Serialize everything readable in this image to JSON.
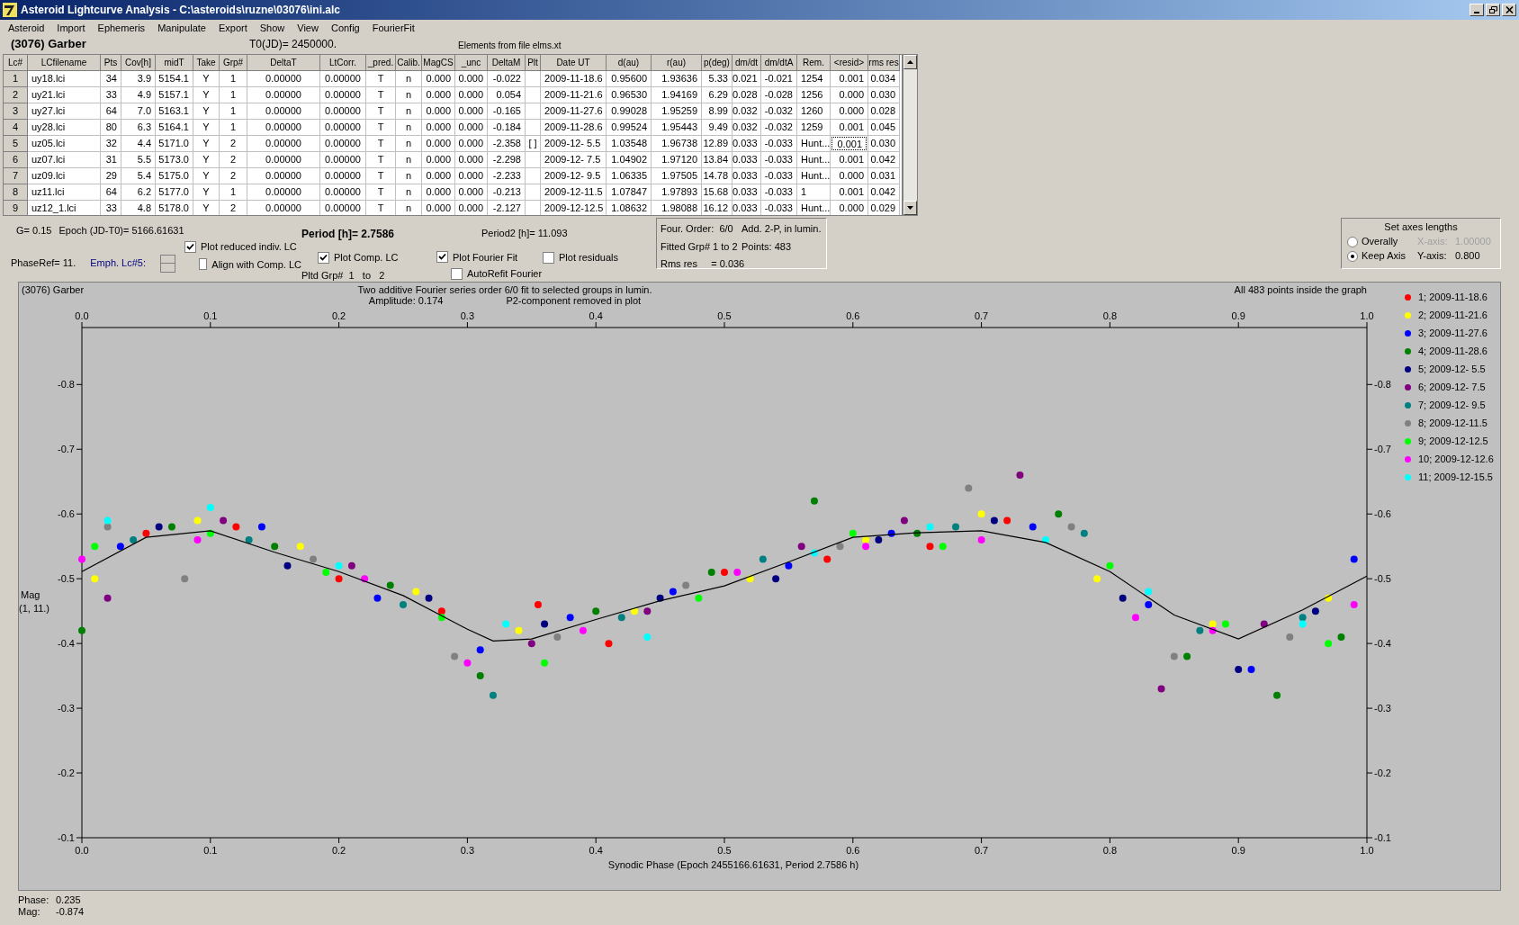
{
  "window": {
    "title": "Asteroid Lightcurve Analysis - C:\\asteroids\\ruzne\\03076\\ini.alc"
  },
  "menu": [
    "Asteroid",
    "Import",
    "Ephemeris",
    "Manipulate",
    "Export",
    "Show",
    "View",
    "Config",
    "FourierFit"
  ],
  "header": {
    "asteroid": "(3076) Garber",
    "t0": "T0(JD)= 2450000.",
    "elements": "Elements from file elms.xt"
  },
  "table": {
    "columns": [
      "Lc#",
      "LCfilename",
      "Pts",
      "Cov[h]",
      "midT",
      "Take",
      "Grp#",
      "DeltaT",
      "LtCorr.",
      "_pred.",
      "Calib.",
      "MagCS",
      "_unc",
      "DeltaM",
      "Plt",
      "Date UT",
      "d(au)",
      "r(au)",
      "p(deg)",
      "dm/dt",
      "dm/dtA",
      "Rem.",
      "<resid>",
      "rms res"
    ],
    "rows": [
      {
        "cells": [
          "1",
          "uy18.lci",
          "34",
          "3.9",
          "5154.1",
          "Y",
          "1",
          "0.00000",
          "0.00000",
          "T",
          "n",
          "0.000",
          "0.000",
          "-0.022",
          null,
          "2009-11-18.6",
          "0.95600",
          "1.93636",
          "5.33",
          "0.021",
          "-0.021",
          "1254",
          "0.001",
          "0.034"
        ],
        "resid_focused": false
      },
      {
        "cells": [
          "2",
          "uy21.lci",
          "33",
          "4.9",
          "5157.1",
          "Y",
          "1",
          "0.00000",
          "0.00000",
          "T",
          "n",
          "0.000",
          "0.000",
          "0.054",
          null,
          "2009-11-21.6",
          "0.96530",
          "1.94169",
          "6.29",
          "0.028",
          "-0.028",
          "1256",
          "0.000",
          "0.030"
        ],
        "resid_focused": false
      },
      {
        "cells": [
          "3",
          "uy27.lci",
          "64",
          "7.0",
          "5163.1",
          "Y",
          "1",
          "0.00000",
          "0.00000",
          "T",
          "n",
          "0.000",
          "0.000",
          "-0.165",
          null,
          "2009-11-27.6",
          "0.99028",
          "1.95259",
          "8.99",
          "0.032",
          "-0.032",
          "1260",
          "0.000",
          "0.028"
        ],
        "resid_focused": false
      },
      {
        "cells": [
          "4",
          "uy28.lci",
          "80",
          "6.3",
          "5164.1",
          "Y",
          "1",
          "0.00000",
          "0.00000",
          "T",
          "n",
          "0.000",
          "0.000",
          "-0.184",
          null,
          "2009-11-28.6",
          "0.99524",
          "1.95443",
          "9.49",
          "0.032",
          "-0.032",
          "1259",
          "0.001",
          "0.045"
        ],
        "resid_focused": false
      },
      {
        "cells": [
          "5",
          "uz05.lci",
          "32",
          "4.4",
          "5171.0",
          "Y",
          "2",
          "0.00000",
          "0.00000",
          "T",
          "n",
          "0.000",
          "0.000",
          "-2.358",
          "[ ]",
          "2009-12- 5.5",
          "1.03548",
          "1.96738",
          "12.89",
          "0.033",
          "-0.033",
          "Hunt...",
          "0.001",
          "0.030"
        ],
        "resid_focused": true
      },
      {
        "cells": [
          "6",
          "uz07.lci",
          "31",
          "5.5",
          "5173.0",
          "Y",
          "2",
          "0.00000",
          "0.00000",
          "T",
          "n",
          "0.000",
          "0.000",
          "-2.298",
          null,
          "2009-12- 7.5",
          "1.04902",
          "1.97120",
          "13.84",
          "0.033",
          "-0.033",
          "Hunt...",
          "0.001",
          "0.042"
        ],
        "resid_focused": false
      },
      {
        "cells": [
          "7",
          "uz09.lci",
          "29",
          "5.4",
          "5175.0",
          "Y",
          "2",
          "0.00000",
          "0.00000",
          "T",
          "n",
          "0.000",
          "0.000",
          "-2.233",
          null,
          "2009-12- 9.5",
          "1.06335",
          "1.97505",
          "14.78",
          "0.033",
          "-0.033",
          "Hunt...",
          "0.000",
          "0.031"
        ],
        "resid_focused": false
      },
      {
        "cells": [
          "8",
          "uz11.lci",
          "64",
          "6.2",
          "5177.0",
          "Y",
          "1",
          "0.00000",
          "0.00000",
          "T",
          "n",
          "0.000",
          "0.000",
          "-0.213",
          null,
          "2009-12-11.5",
          "1.07847",
          "1.97893",
          "15.68",
          "0.033",
          "-0.033",
          "1",
          "0.001",
          "0.042"
        ],
        "resid_focused": false
      },
      {
        "cells": [
          "9",
          "uz12_1.lci",
          "33",
          "4.8",
          "5178.0",
          "Y",
          "2",
          "0.00000",
          "0.00000",
          "T",
          "n",
          "0.000",
          "0.000",
          "-2.127",
          null,
          "2009-12-12.5",
          "1.08632",
          "1.98088",
          "16.12",
          "0.033",
          "-0.033",
          "Hunt...",
          "0.000",
          "0.029"
        ],
        "resid_focused": false
      }
    ]
  },
  "params": {
    "g": "G= 0.15",
    "epoch": "Epoch (JD-T0)= 5166.61631",
    "period": "Period [h]= 2.7586",
    "period2": "Period2 [h]= 11.093",
    "phaseref": "PhaseRef= 11.",
    "emph": "Emph. Lc#5:",
    "pltd_grp": "Pltd Grp#  1   to   2"
  },
  "checkboxes": [
    {
      "label": "Plot reduced indiv. LC",
      "checked": true
    },
    {
      "label": "Align with Comp. LC",
      "checked": false
    },
    {
      "label": "Plot Comp. LC",
      "checked": true
    },
    {
      "label": "Plot Fourier Fit",
      "checked": true
    },
    {
      "label": "AutoRefit Fourier",
      "checked": false
    },
    {
      "label": "Plot residuals",
      "checked": false
    }
  ],
  "fit_info": [
    "Four. Order:  6/0",
    "Add. 2-P, in lumin.",
    "Fitted Grp# 1 to 2",
    "Points: 483",
    "Rms res     = 0.036"
  ],
  "axes_box": {
    "title": "Set axes lengths",
    "options": [
      {
        "label": "Overally",
        "selected": false
      },
      {
        "label": "Keep Axis",
        "selected": true
      }
    ],
    "axes": [
      {
        "label": "X-axis:",
        "value": "1.00000",
        "disabled": true
      },
      {
        "label": "Y-axis:",
        "value": "0.800",
        "disabled": false
      }
    ]
  },
  "plot": {
    "name": "(3076) Garber",
    "subtitle": "Two additive Fourier series order 6/0 fit to selected groups in lumin.",
    "amplitude": "Amplitude: 0.174",
    "note": "P2-component removed in plot",
    "points_note": "All 483 points inside the graph",
    "ylabel_unit": "(1, 11.)",
    "right_axis_labels": [
      "-0.8",
      "-0.7",
      "-0.6",
      "-0.5",
      "-0.4",
      "-0.3",
      "-0.2",
      "-0.1"
    ],
    "chart_data": {
      "type": "scatter",
      "xlabel": "Synodic Phase (Epoch 2455166.61631, Period 2.7586 h)",
      "ylabel": "Mag",
      "xlim": [
        0,
        1
      ],
      "ylim": [
        -0.1,
        -0.888
      ],
      "xticks": [
        {
          "value": 0,
          "label": "0.0"
        },
        {
          "value": 0.1,
          "label": "0.1"
        },
        {
          "value": 0.2,
          "label": "0.2"
        },
        {
          "value": 0.3,
          "label": "0.3"
        },
        {
          "value": 0.4,
          "label": "0.4"
        },
        {
          "value": 0.5,
          "label": "0.5"
        },
        {
          "value": 0.6,
          "label": "0.6"
        },
        {
          "value": 0.7,
          "label": "0.7"
        },
        {
          "value": 0.8,
          "label": "0.8"
        },
        {
          "value": 0.9,
          "label": "0.9"
        },
        {
          "value": 1,
          "label": "1.0"
        }
      ],
      "yticks": [
        -0.1,
        -0.2,
        -0.3,
        -0.4,
        -0.5,
        -0.6,
        -0.7,
        -0.8
      ],
      "series": [
        {
          "name": "1; 2009-11-18.6",
          "color": "#ff0000",
          "x": [
            0.05,
            0.12,
            0.2,
            0.28,
            0.355,
            0.41,
            0.5,
            0.58,
            0.66,
            0.72
          ],
          "values": [
            -0.57,
            -0.58,
            -0.5,
            -0.45,
            -0.46,
            -0.4,
            -0.51,
            -0.53,
            -0.55,
            -0.59
          ]
        },
        {
          "name": "2; 2009-11-21.6",
          "color": "#ffff00",
          "x": [
            0.01,
            0.09,
            0.17,
            0.26,
            0.34,
            0.43,
            0.52,
            0.61,
            0.7,
            0.79,
            0.88,
            0.97
          ],
          "values": [
            -0.5,
            -0.59,
            -0.55,
            -0.48,
            -0.42,
            -0.45,
            -0.5,
            -0.56,
            -0.6,
            -0.5,
            -0.43,
            -0.47
          ]
        },
        {
          "name": "3; 2009-11-27.6",
          "color": "#0000ff",
          "x": [
            0.03,
            0.14,
            0.23,
            0.31,
            0.38,
            0.46,
            0.55,
            0.63,
            0.74,
            0.83,
            0.91,
            0.99
          ],
          "values": [
            -0.55,
            -0.58,
            -0.47,
            -0.39,
            -0.44,
            -0.48,
            -0.52,
            -0.57,
            -0.58,
            -0.46,
            -0.36,
            -0.53
          ]
        },
        {
          "name": "4; 2009-11-28.6",
          "color": "#008000",
          "x": [
            0.0,
            0.07,
            0.15,
            0.24,
            0.31,
            0.4,
            0.49,
            0.57,
            0.65,
            0.76,
            0.86,
            0.93,
            0.98
          ],
          "values": [
            -0.42,
            -0.58,
            -0.55,
            -0.49,
            -0.35,
            -0.45,
            -0.51,
            -0.62,
            -0.57,
            -0.6,
            -0.38,
            -0.32,
            -0.41
          ]
        },
        {
          "name": "5; 2009-12- 5.5",
          "color": "#000080",
          "x": [
            0.06,
            0.16,
            0.27,
            0.36,
            0.45,
            0.54,
            0.62,
            0.71,
            0.81,
            0.9,
            0.96
          ],
          "values": [
            -0.58,
            -0.52,
            -0.47,
            -0.43,
            -0.47,
            -0.5,
            -0.56,
            -0.59,
            -0.47,
            -0.36,
            -0.45
          ]
        },
        {
          "name": "6; 2009-12- 7.5",
          "color": "#800080",
          "x": [
            0.02,
            0.11,
            0.21,
            0.35,
            0.44,
            0.56,
            0.64,
            0.73,
            0.84,
            0.92
          ],
          "values": [
            -0.47,
            -0.59,
            -0.52,
            -0.4,
            -0.45,
            -0.55,
            -0.59,
            -0.66,
            -0.33,
            -0.43
          ]
        },
        {
          "name": "7; 2009-12- 9.5",
          "color": "#008080",
          "x": [
            0.04,
            0.13,
            0.25,
            0.32,
            0.42,
            0.53,
            0.68,
            0.78,
            0.87,
            0.95
          ],
          "values": [
            -0.56,
            -0.56,
            -0.46,
            -0.32,
            -0.44,
            -0.53,
            -0.58,
            -0.57,
            -0.42,
            -0.44
          ]
        },
        {
          "name": "8; 2009-12-11.5",
          "color": "#808080",
          "x": [
            0.02,
            0.08,
            0.18,
            0.29,
            0.37,
            0.47,
            0.59,
            0.69,
            0.77,
            0.85,
            0.94
          ],
          "values": [
            -0.58,
            -0.5,
            -0.53,
            -0.38,
            -0.41,
            -0.49,
            -0.55,
            -0.64,
            -0.58,
            -0.38,
            -0.41
          ]
        },
        {
          "name": "9; 2009-12-12.5",
          "color": "#00ff00",
          "x": [
            0.01,
            0.1,
            0.19,
            0.28,
            0.36,
            0.48,
            0.6,
            0.67,
            0.8,
            0.89,
            0.97
          ],
          "values": [
            -0.55,
            -0.57,
            -0.51,
            -0.44,
            -0.37,
            -0.47,
            -0.57,
            -0.55,
            -0.52,
            -0.43,
            -0.4
          ]
        },
        {
          "name": "10; 2009-12-12.6",
          "color": "#ff00ff",
          "x": [
            0.0,
            0.09,
            0.22,
            0.3,
            0.39,
            0.51,
            0.61,
            0.7,
            0.82,
            0.88,
            0.99
          ],
          "values": [
            -0.53,
            -0.56,
            -0.5,
            -0.37,
            -0.42,
            -0.51,
            -0.55,
            -0.56,
            -0.44,
            -0.42,
            -0.46
          ]
        },
        {
          "name": "11; 2009-12-15.5",
          "color": "#00ffff",
          "x": [
            0.02,
            0.1,
            0.2,
            0.33,
            0.44,
            0.57,
            0.66,
            0.75,
            0.83,
            0.95
          ],
          "values": [
            -0.59,
            -0.61,
            -0.52,
            -0.43,
            -0.41,
            -0.54,
            -0.58,
            -0.56,
            -0.48,
            -0.43
          ]
        },
        {
          "type": "line",
          "color": "#000000",
          "x": [
            0,
            0.05,
            0.1,
            0.15,
            0.2,
            0.25,
            0.3,
            0.32,
            0.35,
            0.4,
            0.45,
            0.5,
            0.55,
            0.6,
            0.65,
            0.7,
            0.75,
            0.8,
            0.85,
            0.9,
            0.95,
            1.0
          ],
          "values": [
            -0.511,
            -0.564,
            -0.574,
            -0.541,
            -0.511,
            -0.474,
            -0.422,
            -0.404,
            -0.407,
            -0.437,
            -0.466,
            -0.489,
            -0.526,
            -0.564,
            -0.571,
            -0.574,
            -0.556,
            -0.511,
            -0.444,
            -0.407,
            -0.452,
            -0.504
          ]
        }
      ]
    }
  },
  "status": {
    "phase_label": "Phase:",
    "phase": "0.235",
    "mag_label": "Mag:",
    "mag": "-0.874"
  }
}
